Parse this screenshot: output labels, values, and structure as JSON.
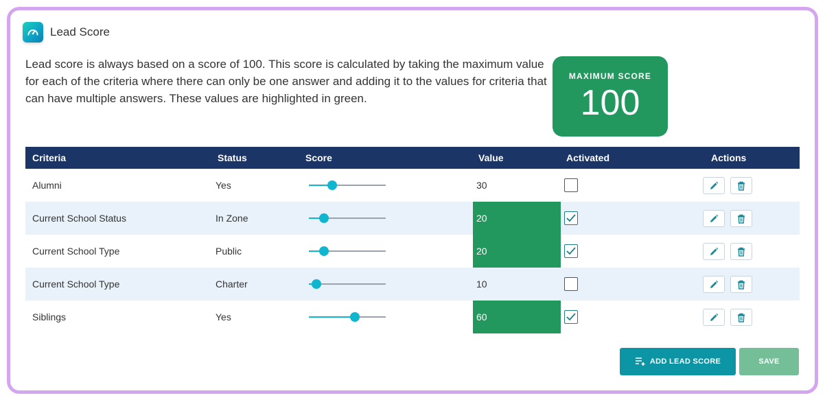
{
  "header": {
    "title": "Lead Score",
    "icon": "speedometer-icon"
  },
  "description": "Lead score is always based on a score of 100. This score is calculated by taking the maximum value for each of the criteria where there can only be one answer and adding it to the values for criteria that can have multiple answers. These values are highlighted in green.",
  "max_score": {
    "label": "MAXIMUM SCORE",
    "value": "100"
  },
  "table": {
    "headers": {
      "criteria": "Criteria",
      "status": "Status",
      "score": "Score",
      "value": "Value",
      "activated": "Activated",
      "actions": "Actions"
    },
    "rows": [
      {
        "criteria": "Alumni",
        "status": "Yes",
        "value": "30",
        "slider_fraction": 0.3,
        "activated": false,
        "highlighted": false
      },
      {
        "criteria": "Current School Status",
        "status": "In Zone",
        "value": "20",
        "slider_fraction": 0.2,
        "activated": true,
        "highlighted": true
      },
      {
        "criteria": "Current School Type",
        "status": "Public",
        "value": "20",
        "slider_fraction": 0.2,
        "activated": true,
        "highlighted": true
      },
      {
        "criteria": "Current School Type",
        "status": "Charter",
        "value": "10",
        "slider_fraction": 0.1,
        "activated": false,
        "highlighted": false
      },
      {
        "criteria": "Siblings",
        "status": "Yes",
        "value": "60",
        "slider_fraction": 0.6,
        "activated": true,
        "highlighted": true
      }
    ]
  },
  "buttons": {
    "add_label": "ADD LEAD SCORE",
    "save_label": "SAVE"
  },
  "colors": {
    "accent": "#0b95a5",
    "highlight": "#22975e",
    "header_bg": "#1a3566",
    "frame": "#d4a6f0",
    "save": "#74bf98"
  }
}
